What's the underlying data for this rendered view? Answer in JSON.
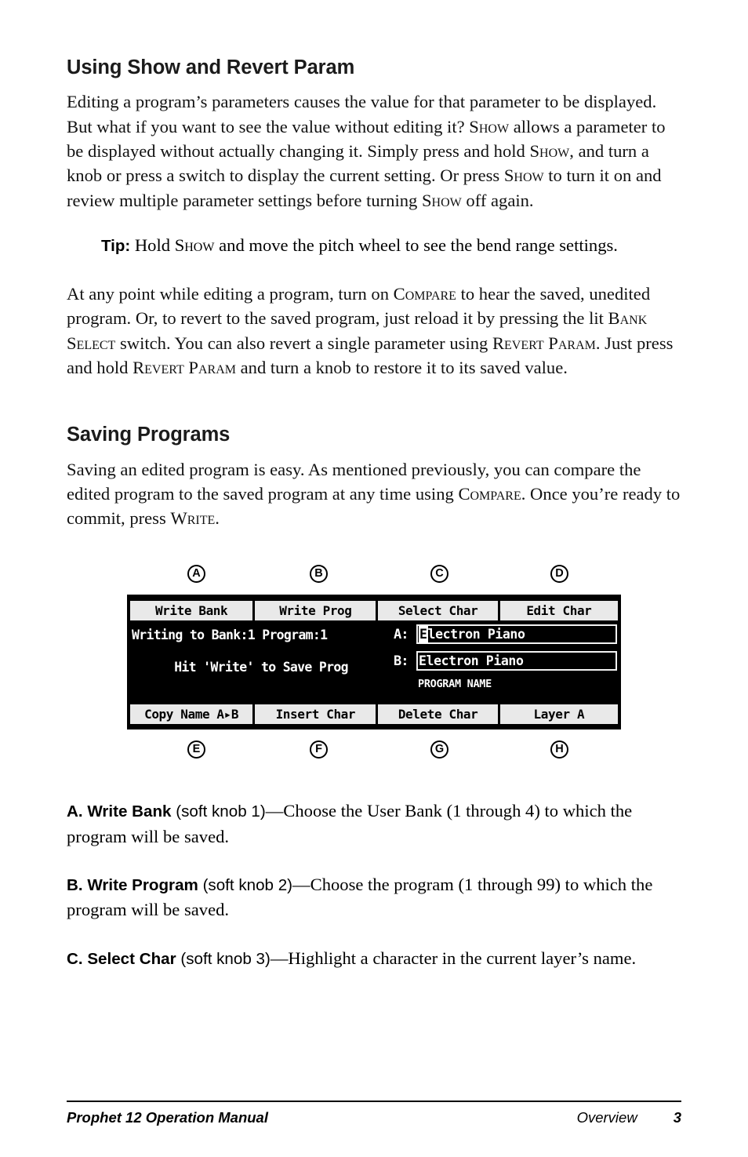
{
  "document": {
    "title": "Prophet 12 Operation Manual",
    "section": "Overview",
    "page_number": "3"
  },
  "sections": [
    {
      "heading": "Using Show and Revert Param",
      "paragraphs": [
        {
          "runs": [
            {
              "text": "Editing a program’s parameters causes the value for that parameter to be displayed. But what if you want to see the value without editing it? ",
              "style": "normal"
            },
            {
              "text": "Show",
              "style": "smallcaps"
            },
            {
              "text": " allows a parameter to be displayed without actually changing it. Simply press and hold ",
              "style": "normal"
            },
            {
              "text": "Show",
              "style": "smallcaps"
            },
            {
              "text": ", and turn a knob or press a switch to display the current setting. Or press ",
              "style": "normal"
            },
            {
              "text": "Show",
              "style": "smallcaps"
            },
            {
              "text": " to turn it on and review multiple parameter settings before turning ",
              "style": "normal"
            },
            {
              "text": "Show",
              "style": "smallcaps"
            },
            {
              "text": " off again.",
              "style": "normal"
            }
          ]
        }
      ],
      "tip": {
        "label": "Tip:",
        "runs": [
          {
            "text": " Hold ",
            "style": "normal"
          },
          {
            "text": "Show",
            "style": "smallcaps"
          },
          {
            "text": " and move the pitch wheel to see the bend range settings.",
            "style": "normal"
          }
        ]
      },
      "paragraphs_after_tip": [
        {
          "runs": [
            {
              "text": "At any point while editing a program, turn on ",
              "style": "normal"
            },
            {
              "text": "Compare",
              "style": "smallcaps"
            },
            {
              "text": " to hear the saved, unedited program. Or, to revert to the saved program, just reload it by pressing the lit ",
              "style": "normal"
            },
            {
              "text": "Bank Select",
              "style": "smallcaps"
            },
            {
              "text": " switch. You can also revert a single parameter using ",
              "style": "normal"
            },
            {
              "text": "Revert Param",
              "style": "smallcaps"
            },
            {
              "text": ". Just press and hold ",
              "style": "normal"
            },
            {
              "text": "Revert Param",
              "style": "smallcaps"
            },
            {
              "text": " and turn a knob to restore it to its saved value.",
              "style": "normal"
            }
          ]
        }
      ]
    },
    {
      "heading": "Saving Programs",
      "paragraphs": [
        {
          "runs": [
            {
              "text": "Saving an edited program is easy. As mentioned previously, you can compare the edited program to the saved program at any time using ",
              "style": "normal"
            },
            {
              "text": "Compare",
              "style": "smallcaps"
            },
            {
              "text": ". Once you’re ready to commit, press ",
              "style": "normal"
            },
            {
              "text": "Write",
              "style": "smallcaps"
            },
            {
              "text": ".",
              "style": "normal"
            }
          ]
        }
      ]
    }
  ],
  "figure": {
    "callouts_top": [
      "A",
      "B",
      "C",
      "D"
    ],
    "callouts_bottom": [
      "E",
      "F",
      "G",
      "H"
    ],
    "lcd": {
      "softkeys_top": [
        "Write Bank",
        "Write Prog",
        "Select Char",
        "Edit Char"
      ],
      "softkeys_bottom": [
        "Copy Name A▸B",
        "Insert Char",
        "Delete Char",
        "Layer A"
      ],
      "status_line_1": "Writing to Bank:1  Program:1",
      "status_line_2": "Hit 'Write' to Save Prog",
      "layer_a_label": "A:",
      "layer_a_cursor_char": "E",
      "layer_a_name_rest": "lectron Piano",
      "layer_b_label": "B:",
      "layer_b_name": "Electron Piano",
      "name_caption": "PROGRAM NAME"
    }
  },
  "items": [
    {
      "letter_title": "A. Write Bank",
      "knob": " (soft knob 1)",
      "description": "—Choose the User Bank (1 through 4) to which the program will be saved."
    },
    {
      "letter_title": "B. Write Program",
      "knob": " (soft knob 2)",
      "description": "—Choose the program (1 through 99) to which the program will be saved."
    },
    {
      "letter_title": "C. Select Char",
      "knob": " (soft knob 3)",
      "description": "—Highlight a character in the current layer’s name."
    }
  ],
  "colors": {
    "lcd_background": "#000000",
    "lcd_text": "#ffffff",
    "softkey_background": "#e9e9e9",
    "page_background": "#ffffff",
    "body_text": "#111111"
  }
}
